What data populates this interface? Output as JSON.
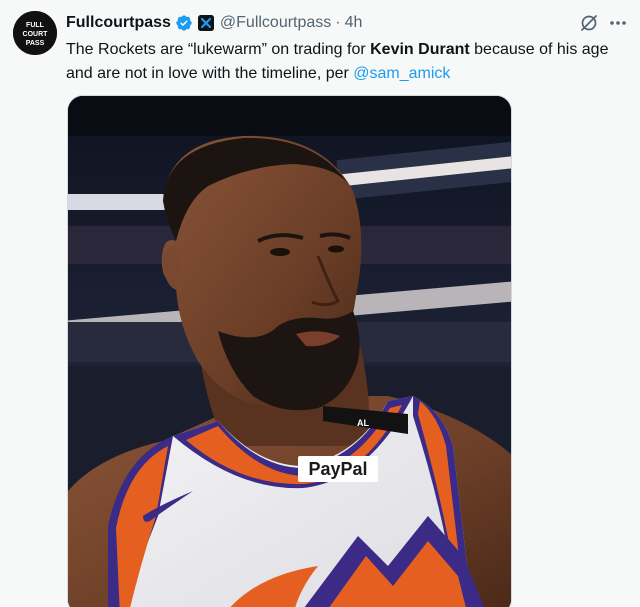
{
  "author": {
    "display_name": "Fullcourtpass",
    "handle": "@Fullcourtpass",
    "separator": "·",
    "timestamp": "4h",
    "avatar_text": [
      "FULL",
      "COURT",
      "PASS"
    ],
    "verified_icon": "verified-badge-icon",
    "affiliate_icon": "affiliate-badge-icon"
  },
  "tweet": {
    "text_before": "The Rockets are “lukewarm” on trading for ",
    "text_bold": "Kevin Durant",
    "text_after": " because of his age and are not in love with the timeline, per ",
    "mention": "@sam_amick"
  },
  "media": {
    "jersey_sponsor": "PayPal",
    "armband_text": "AL"
  },
  "actions": {
    "grok_icon": "grok-icon",
    "more_icon": "more-options-icon"
  },
  "colors": {
    "link": "#1d9bf0",
    "verified": "#1d9bf0",
    "jersey_purple": "#3b2a86",
    "jersey_orange": "#e56020"
  }
}
